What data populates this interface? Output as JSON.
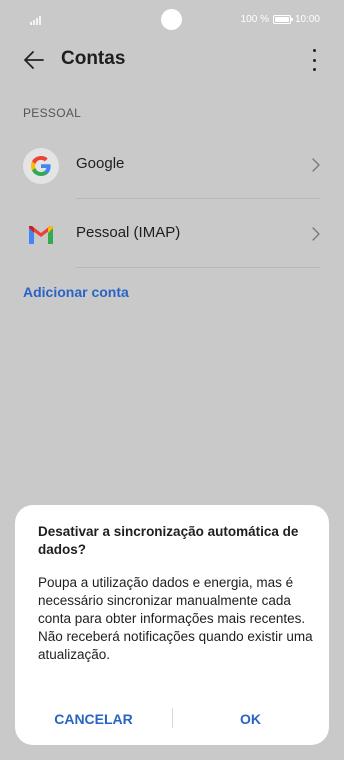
{
  "status_bar": {
    "battery_text": "100 %",
    "time": "10:00"
  },
  "header": {
    "title": "Contas",
    "back_icon": "arrow-left-icon",
    "more_icon": "more-vertical-icon"
  },
  "section": {
    "label": "PESSOAL"
  },
  "accounts": [
    {
      "label": "Google",
      "icon": "google-icon"
    },
    {
      "label": "Pessoal (IMAP)",
      "icon": "gmail-icon"
    }
  ],
  "add_account": {
    "label": "Adicionar conta"
  },
  "dialog": {
    "title": "Desativar a sincronização automática de dados?",
    "body": "Poupa a utilização dados e energia, mas é necessário sincronizar manualmente cada conta para obter informações mais recentes. Não receberá notificações quando existir uma atualização.",
    "cancel_label": "CANCELAR",
    "ok_label": "OK"
  },
  "colors": {
    "accent": "#2a63c4",
    "dim_background": "#c9c9c9"
  }
}
